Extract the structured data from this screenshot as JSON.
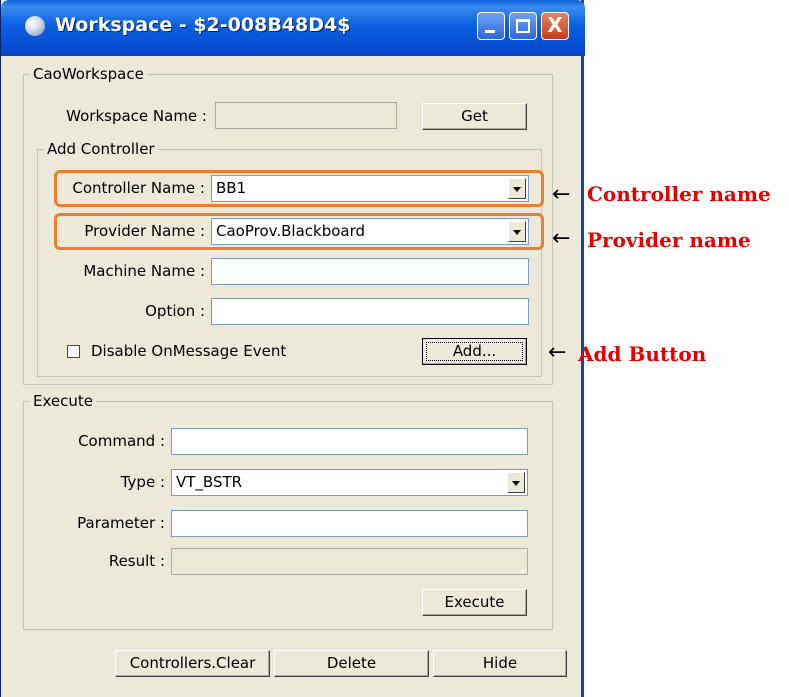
{
  "window": {
    "title": "Workspace - $2-008B48D4$",
    "controls": {
      "minimize": "minimize",
      "maximize": "maximize",
      "close": "X"
    }
  },
  "cao_workspace": {
    "group_label": "CaoWorkspace",
    "workspace_name_label": "Workspace Name :",
    "workspace_name_value": "",
    "get_button": "Get"
  },
  "add_controller": {
    "group_label": "Add Controller",
    "controller_name_label": "Controller Name :",
    "controller_name_value": "BB1",
    "provider_name_label": "Provider Name :",
    "provider_name_value": "CaoProv.Blackboard",
    "machine_name_label": "Machine Name :",
    "machine_name_value": "",
    "option_label": "Option :",
    "option_value": "",
    "disable_event_label": "Disable OnMessage Event",
    "disable_event_checked": false,
    "add_button": "Add..."
  },
  "execute": {
    "group_label": "Execute",
    "command_label": "Command :",
    "command_value": "",
    "type_label": "Type :",
    "type_value": "VT_BSTR",
    "parameter_label": "Parameter :",
    "parameter_value": "",
    "result_label": "Result :",
    "result_value": "",
    "execute_button": "Execute"
  },
  "bottom_buttons": {
    "clear": "Controllers.Clear",
    "delete": "Delete",
    "hide": "Hide"
  },
  "annotations": {
    "arrow": "←",
    "controller_name": "Controller name",
    "provider_name": "Provider name",
    "add_button": "Add Button",
    "highlight_color": "#ed7d31",
    "text_color": "#e60000"
  }
}
